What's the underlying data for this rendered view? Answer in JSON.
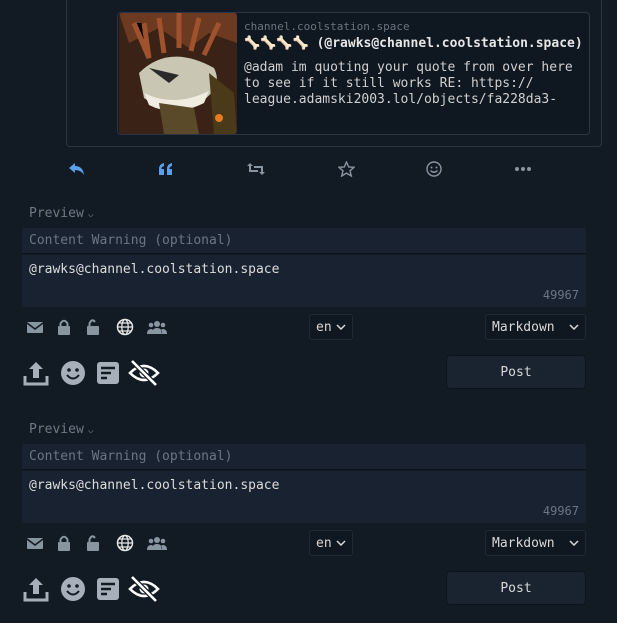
{
  "quote": {
    "host": "channel.coolstation.space",
    "name": "🦴🦴🦴🦴 (@rawks@channel.coolstation.space)",
    "text": "@adam im quoting your quote from over here to see if it still works RE: https:// league.adamski2003.lol/objects/fa228da3-"
  },
  "actions": [
    "reply-icon",
    "quote-icon",
    "repeat-icon",
    "favorite-icon",
    "react-icon",
    "more-icon"
  ],
  "editors": [
    {
      "preview_label": "Preview",
      "cw_placeholder": "Content Warning (optional)",
      "text": "@rawks@channel.coolstation.space",
      "counter": "49967",
      "language": "en",
      "format": "Markdown",
      "post_label": "Post"
    },
    {
      "preview_label": "Preview",
      "cw_placeholder": "Content Warning (optional)",
      "text": "@rawks@channel.coolstation.space",
      "counter": "49967",
      "language": "en",
      "format": "Markdown",
      "post_label": "Post"
    }
  ],
  "colors": {
    "accent": "#5aa0e8",
    "bg": "#121a24",
    "field": "#182230"
  }
}
